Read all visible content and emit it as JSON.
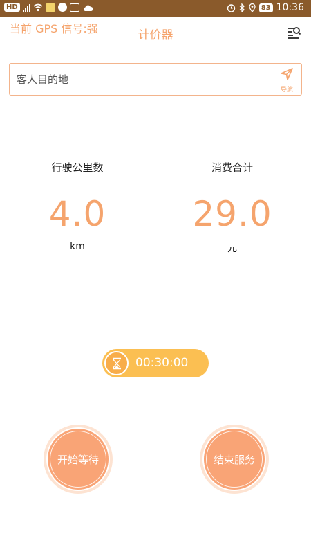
{
  "status_bar": {
    "left_badge": "HD",
    "battery": "83",
    "time": "10:36"
  },
  "header": {
    "gps_status": "当前 GPS 信号:强",
    "title": "计价器",
    "menu_icon": "list-search-icon"
  },
  "destination": {
    "placeholder": "客人目的地",
    "value": "",
    "nav_label": "导航",
    "nav_icon": "send-arrow-icon"
  },
  "stats": {
    "distance_label": "行驶公里数",
    "distance_value": "4.0",
    "distance_unit": "km",
    "cost_label": "消费合计",
    "cost_value": "29.0",
    "cost_unit": "元"
  },
  "timer": {
    "icon": "hourglass-icon",
    "value": "00:30:00"
  },
  "actions": {
    "start_wait": "开始等待",
    "end_service": "结束服务"
  },
  "colors": {
    "accent": "#f5a46d",
    "status_bar": "#8a5a2b",
    "timer_bg": "#fbbf52",
    "button_bg": "#f9a476"
  }
}
